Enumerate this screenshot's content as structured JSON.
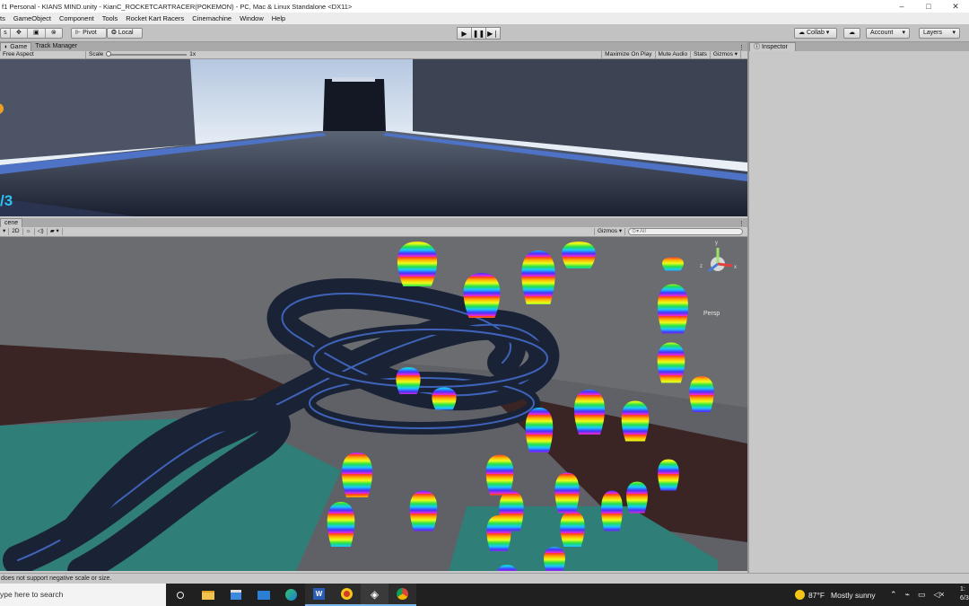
{
  "window": {
    "title": "f1 Personal - KIANS MIND.unity - KianC_ROCKETCARTRACER(POKEMON) - PC, Mac & Linux Standalone <DX11>",
    "controls": [
      "–",
      "□",
      "✕"
    ]
  },
  "menu": [
    "ts",
    "GameObject",
    "Component",
    "Tools",
    "Rocket Kart Racers",
    "Cinemachine",
    "Window",
    "Help"
  ],
  "toolbar": {
    "pivot": "Pivot",
    "local": "Local",
    "collab": "Collab ▾",
    "account": "Account",
    "layers": "Layers"
  },
  "game_panel": {
    "tabs": [
      "Game",
      "Track Manager"
    ],
    "aspect": "Free Aspect",
    "scale_label": "Scale",
    "scale_value": "1x",
    "options": [
      "Maximize On Play",
      "Mute Audio",
      "Stats",
      "Gizmos"
    ],
    "hud_lap": "/3"
  },
  "scene_panel": {
    "tab": "cene",
    "mode_2d": "2D",
    "gizmos": "Gizmos",
    "search_placeholder": "All",
    "persp": "Persp",
    "axis_labels": {
      "y": "y",
      "x": "x",
      "z": "z"
    }
  },
  "inspector": {
    "tab": "Inspector"
  },
  "status": {
    "message": "does not support negative scale or size."
  },
  "taskbar": {
    "search_placeholder": "ype here to search",
    "weather_temp": "87°F",
    "weather_text": "Mostly sunny",
    "clock_line1": "1:",
    "clock_line2": "6/3"
  }
}
